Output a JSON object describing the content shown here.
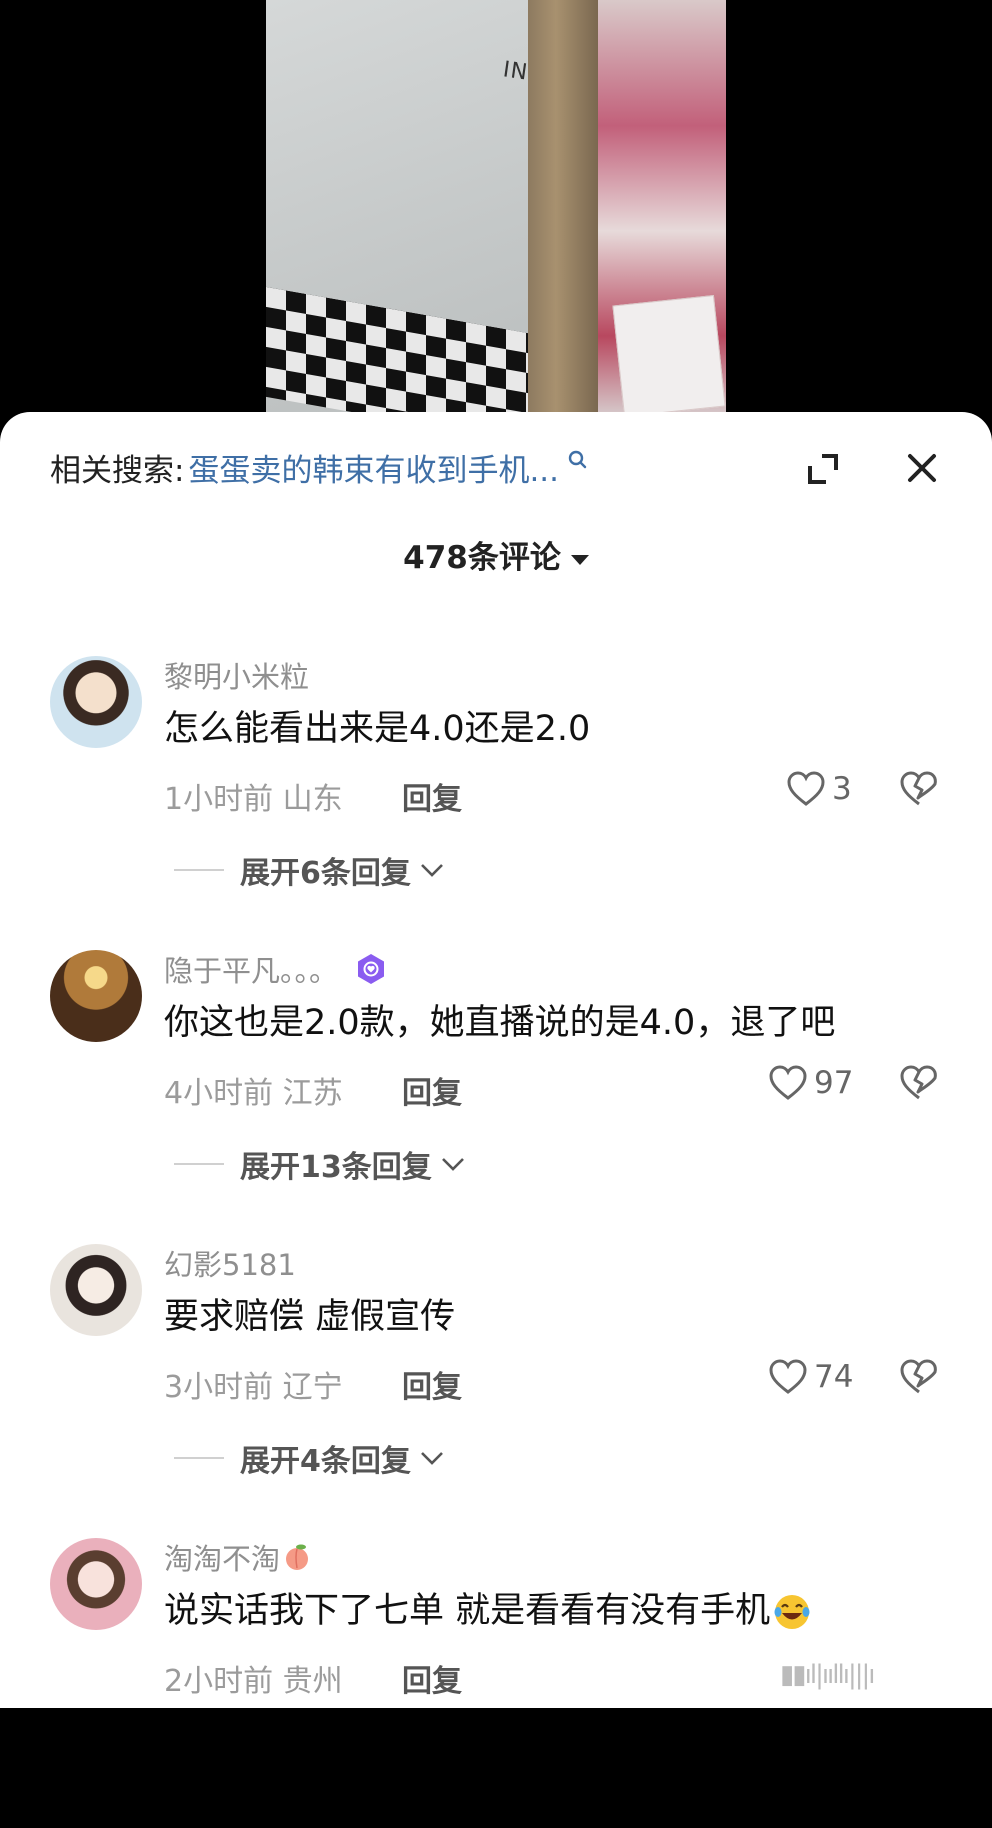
{
  "related_search": {
    "prefix": "相关搜索:",
    "query": "蛋蛋卖的韩束有收到手机..."
  },
  "comments_header": {
    "count_label": "478条评论"
  },
  "video": {
    "brand_text": "INS"
  },
  "comments": [
    {
      "username": "黎明小米粒",
      "text": "怎么能看出来是4.0还是2.0",
      "time_location": "1小时前 山东",
      "reply_label": "回复",
      "likes": "3",
      "expand_label": "展开6条回复",
      "avatar_colors": [
        "#d9c8b5",
        "#7b6a5a"
      ]
    },
    {
      "username": "隐于平凡。。。",
      "text": "你这也是2.0款，她直播说的是4.0，退了吧",
      "time_location": "4小时前 江苏",
      "reply_label": "回复",
      "likes": "97",
      "expand_label": "展开13条回复",
      "avatar_colors": [
        "#c8a060",
        "#5a3a1a"
      ]
    },
    {
      "username": "幻影5181",
      "text": "要求赔偿 虚假宣传",
      "time_location": "3小时前 辽宁",
      "reply_label": "回复",
      "likes": "74",
      "expand_label": "展开4条回复",
      "avatar_colors": [
        "#ece6e0",
        "#3a3030"
      ]
    },
    {
      "username": "淘淘不淘",
      "text": "说实话我下了七单 就是看看有没有手机",
      "time_location": "2小时前 贵州",
      "reply_label": "回复",
      "avatar_colors": [
        "#e8b8c0",
        "#6a4a3a"
      ]
    }
  ],
  "colors": {
    "link": "#3f6fa6",
    "badge": "#8a5cf0",
    "meta": "#9b9b9b"
  }
}
